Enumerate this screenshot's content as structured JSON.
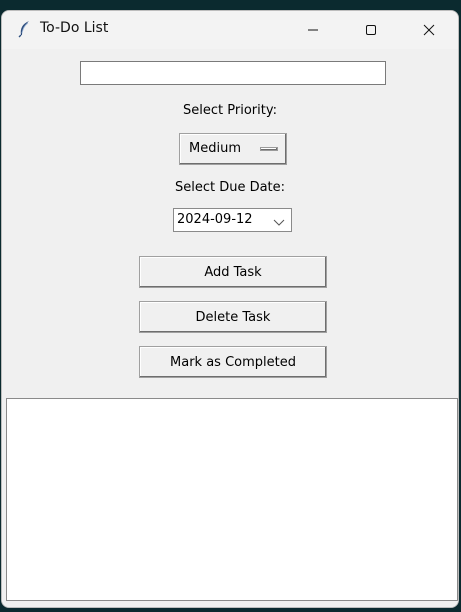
{
  "window": {
    "title": "To-Do List",
    "app_icon": "feather-icon",
    "controls": {
      "minimize_icon": "minimize-icon",
      "maximize_icon": "maximize-icon",
      "close_icon": "close-icon"
    }
  },
  "form": {
    "task_entry": {
      "value": "",
      "placeholder": ""
    },
    "priority_label": "Select Priority:",
    "priority_value": "Medium",
    "due_date_label": "Select Due Date:",
    "due_date_value": "2024-09-12"
  },
  "buttons": {
    "add": "Add Task",
    "delete": "Delete Task",
    "complete": "Mark as Completed"
  },
  "task_list": {
    "items": []
  },
  "colors": {
    "window_bg": "#f0f0f0",
    "titlebar_bg": "#f3f3f3",
    "list_bg": "#ffffff",
    "desktop_bg": "#0b2a2f"
  }
}
